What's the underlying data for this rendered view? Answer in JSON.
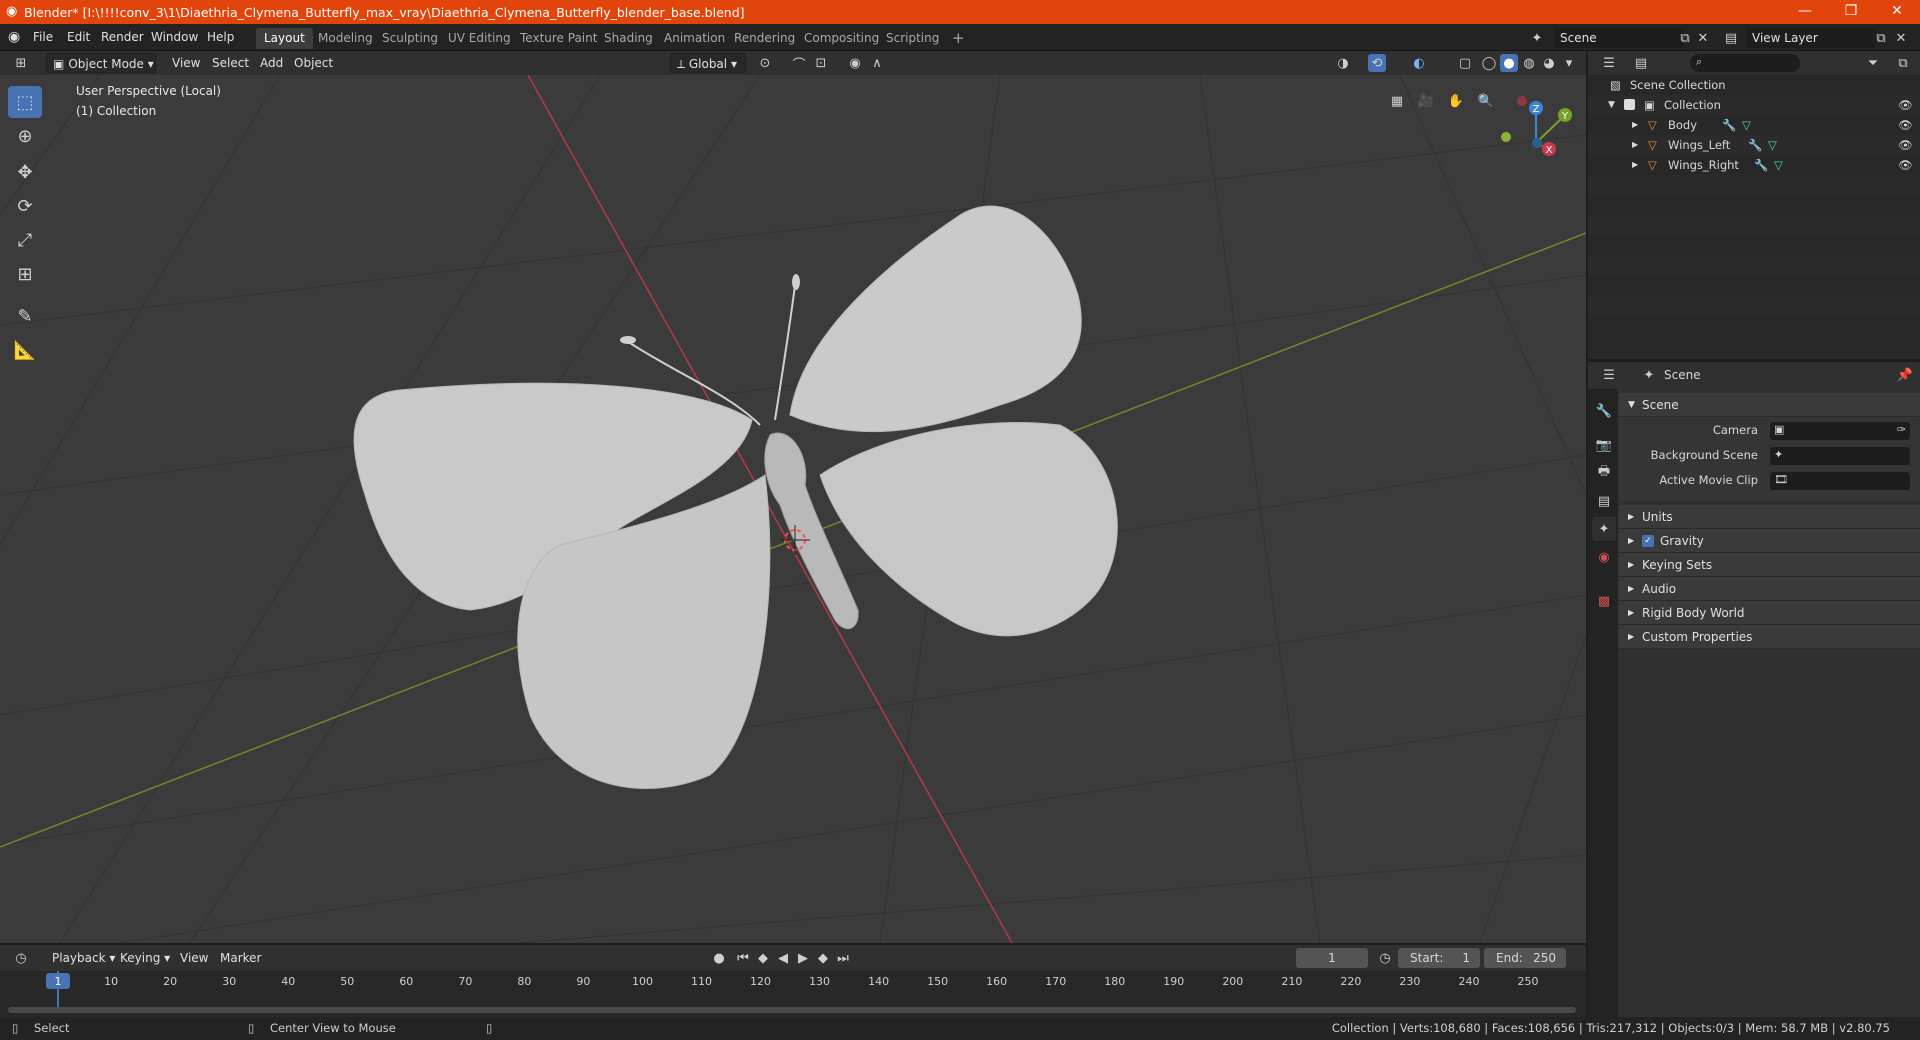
{
  "window": {
    "title": "Blender* [I:\\!!!!conv_3\\1\\Diaethria_Clymena_Butterfly_max_vray\\Diaethria_Clymena_Butterfly_blender_base.blend]"
  },
  "menu": {
    "items": [
      "File",
      "Edit",
      "Render",
      "Window",
      "Help"
    ]
  },
  "workspaces": [
    "Layout",
    "Modeling",
    "Sculpting",
    "UV Editing",
    "Texture Paint",
    "Shading",
    "Animation",
    "Rendering",
    "Compositing",
    "Scripting"
  ],
  "active_workspace": "Layout",
  "scene_selector": "Scene",
  "view_layer_selector": "View Layer",
  "viewport": {
    "mode": "Object Mode",
    "menus": [
      "View",
      "Select",
      "Add",
      "Object"
    ],
    "transform_orientation": "Global",
    "overlay_text_1": "User Perspective (Local)",
    "overlay_text_2": "(1) Collection",
    "gizmo_axes": [
      "Z",
      "Y",
      "X"
    ]
  },
  "outliner": {
    "root": "Scene Collection",
    "collection": "Collection",
    "objects": [
      "Body",
      "Wings_Left",
      "Wings_Right"
    ]
  },
  "properties": {
    "context": "Scene",
    "panel_title": "Scene",
    "fields": {
      "camera": "Camera",
      "background_scene": "Background Scene",
      "active_movie_clip": "Active Movie Clip"
    },
    "collapsed_panels": [
      "Units",
      "Gravity",
      "Keying Sets",
      "Audio",
      "Rigid Body World",
      "Custom Properties"
    ],
    "gravity_checked": true
  },
  "timeline": {
    "menus": [
      "Playback",
      "Keying",
      "View",
      "Marker"
    ],
    "current_frame": "1",
    "start_label": "Start:",
    "start": "1",
    "end_label": "End:",
    "end": "250",
    "ticks": [
      "1",
      "10",
      "20",
      "30",
      "40",
      "50",
      "60",
      "70",
      "80",
      "90",
      "100",
      "110",
      "120",
      "130",
      "140",
      "150",
      "160",
      "170",
      "180",
      "190",
      "200",
      "210",
      "220",
      "230",
      "240",
      "250"
    ]
  },
  "statusbar": {
    "left_action": "Select",
    "middle_action": "Center View to Mouse",
    "stats": "Collection | Verts:108,680 | Faces:108,656 | Tris:217,312 | Objects:0/3 | Mem: 58.7 MB | v2.80.75"
  },
  "colors": {
    "title_bar": "#e2450b",
    "accent_blue": "#4772b3",
    "x_axis": "#c63c4a",
    "y_axis": "#7aa12a",
    "z_axis": "#3b86d6",
    "mesh": "#c8c8c8"
  }
}
